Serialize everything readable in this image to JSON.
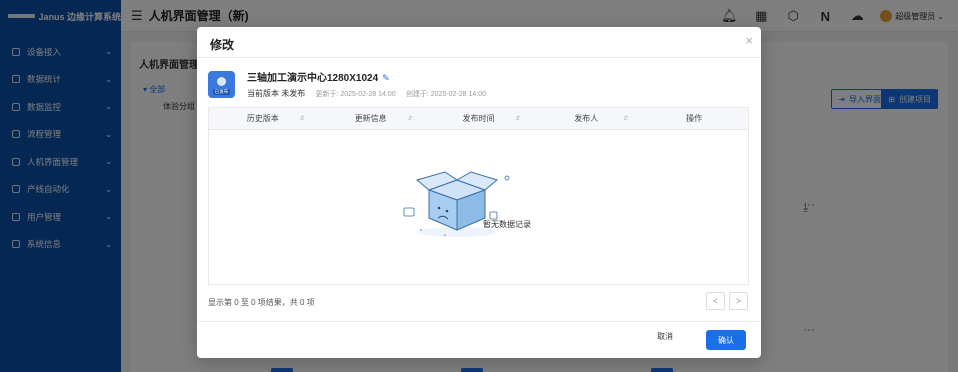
{
  "app": {
    "logo_text": "Janus 边缘计算系统"
  },
  "sidebar": {
    "items": [
      {
        "label": "设备接入",
        "icon": "device-icon"
      },
      {
        "label": "数据统计",
        "icon": "stats-icon"
      },
      {
        "label": "数据监控",
        "icon": "monitor-icon"
      },
      {
        "label": "流程管理",
        "icon": "flow-icon"
      },
      {
        "label": "人机界面管理",
        "icon": "hmi-icon"
      },
      {
        "label": "产线自动化",
        "icon": "automation-icon"
      },
      {
        "label": "用户管理",
        "icon": "user-icon"
      },
      {
        "label": "系统信息",
        "icon": "system-icon"
      }
    ]
  },
  "header": {
    "title": "人机界面管理（新)",
    "user_name": "超级管理员",
    "icons": [
      "bell-icon",
      "apps-icon",
      "api-icon",
      "n-icon",
      "cloud-icon"
    ]
  },
  "background": {
    "page_heading": "人机界面管理",
    "tree_root": "全部",
    "tree_child": "体验分组",
    "import_button": "导入界面",
    "create_button": "创建项目"
  },
  "modal": {
    "title": "修改",
    "project": {
      "name": "三轴加工演示中心1280X1024",
      "icon_tag": "已发布",
      "current_version": "当前版本 未发布",
      "updated": "更新于: 2025-02-28 14:00",
      "created": "创建于: 2025-02-28 14:00"
    },
    "table": {
      "columns": [
        "历史版本",
        "更新信息",
        "发布时间",
        "发布人",
        "操作"
      ],
      "rows": [],
      "empty_text": "暂无数据记录"
    },
    "pager": {
      "info": "显示第 0 至 0 项结果，共 0 项",
      "prev": "<",
      "next": ">"
    },
    "cancel_label": "取消",
    "ok_label": "确认"
  },
  "colors": {
    "primary": "#1a6fe8",
    "sidebar": "#0a4ea6"
  }
}
